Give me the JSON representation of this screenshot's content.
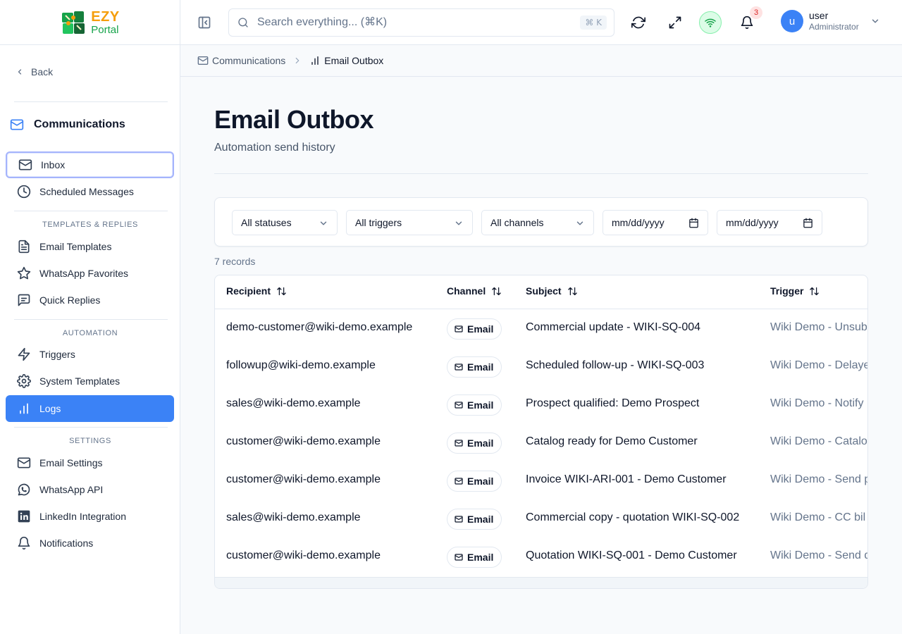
{
  "brand": {
    "line1": "EZY",
    "line2": "Portal"
  },
  "sidebar": {
    "back_label": "Back",
    "section_title": "Communications",
    "items_top": [
      {
        "label": "Inbox",
        "icon": "mail-icon"
      },
      {
        "label": "Scheduled Messages",
        "icon": "clock-icon"
      }
    ],
    "group_templates": "TEMPLATES & REPLIES",
    "items_templates": [
      {
        "label": "Email Templates",
        "icon": "file-text-icon"
      },
      {
        "label": "WhatsApp Favorites",
        "icon": "star-icon"
      },
      {
        "label": "Quick Replies",
        "icon": "message-square-icon"
      }
    ],
    "group_automation": "AUTOMATION",
    "items_automation": [
      {
        "label": "Triggers",
        "icon": "zap-icon"
      },
      {
        "label": "System Templates",
        "icon": "settings-icon"
      },
      {
        "label": "Logs",
        "icon": "bar-chart-icon"
      }
    ],
    "group_settings": "SETTINGS",
    "items_settings": [
      {
        "label": "Email Settings",
        "icon": "mail-icon"
      },
      {
        "label": "WhatsApp API",
        "icon": "whatsapp-icon"
      },
      {
        "label": "LinkedIn Integration",
        "icon": "linkedin-icon"
      },
      {
        "label": "Notifications",
        "icon": "bell-icon"
      }
    ]
  },
  "topbar": {
    "search_placeholder": "Search everything... (⌘K)",
    "search_shortcut": "⌘ K",
    "notification_count": "3",
    "user_name": "user",
    "user_role": "Administrator",
    "avatar_initial": "u"
  },
  "breadcrumb": {
    "parent": "Communications",
    "current": "Email Outbox"
  },
  "page": {
    "title": "Email Outbox",
    "subtitle": "Automation send history"
  },
  "filters": {
    "status": "All statuses",
    "trigger": "All triggers",
    "channel": "All channels",
    "date_from": "mm/dd/yyyy",
    "date_to": "mm/dd/yyyy"
  },
  "records_label": "7 records",
  "table": {
    "columns": [
      "Recipient",
      "Channel",
      "Subject",
      "Trigger"
    ],
    "rows": [
      {
        "recipient": "demo-customer@wiki-demo.example",
        "channel": "Email",
        "subject": "Commercial update - WIKI-SQ-004",
        "trigger": "Wiki Demo - Unsubscribe"
      },
      {
        "recipient": "followup@wiki-demo.example",
        "channel": "Email",
        "subject": "Scheduled follow-up - WIKI-SQ-003",
        "trigger": "Wiki Demo - Delayed"
      },
      {
        "recipient": "sales@wiki-demo.example",
        "channel": "Email",
        "subject": "Prospect qualified: Demo Prospect",
        "trigger": "Wiki Demo - Notify"
      },
      {
        "recipient": "customer@wiki-demo.example",
        "channel": "Email",
        "subject": "Catalog ready for Demo Customer",
        "trigger": "Wiki Demo - Catalog"
      },
      {
        "recipient": "customer@wiki-demo.example",
        "channel": "Email",
        "subject": "Invoice WIKI-ARI-001 - Demo Customer",
        "trigger": "Wiki Demo - Send p"
      },
      {
        "recipient": "sales@wiki-demo.example",
        "channel": "Email",
        "subject": "Commercial copy - quotation WIKI-SQ-002",
        "trigger": "Wiki Demo - CC bil"
      },
      {
        "recipient": "customer@wiki-demo.example",
        "channel": "Email",
        "subject": "Quotation WIKI-SQ-001 - Demo Customer",
        "trigger": "Wiki Demo - Send q"
      }
    ]
  },
  "colors": {
    "accent": "#3b82f6",
    "active_outline": "#a5b4fc",
    "status_online": "#16a34a"
  }
}
